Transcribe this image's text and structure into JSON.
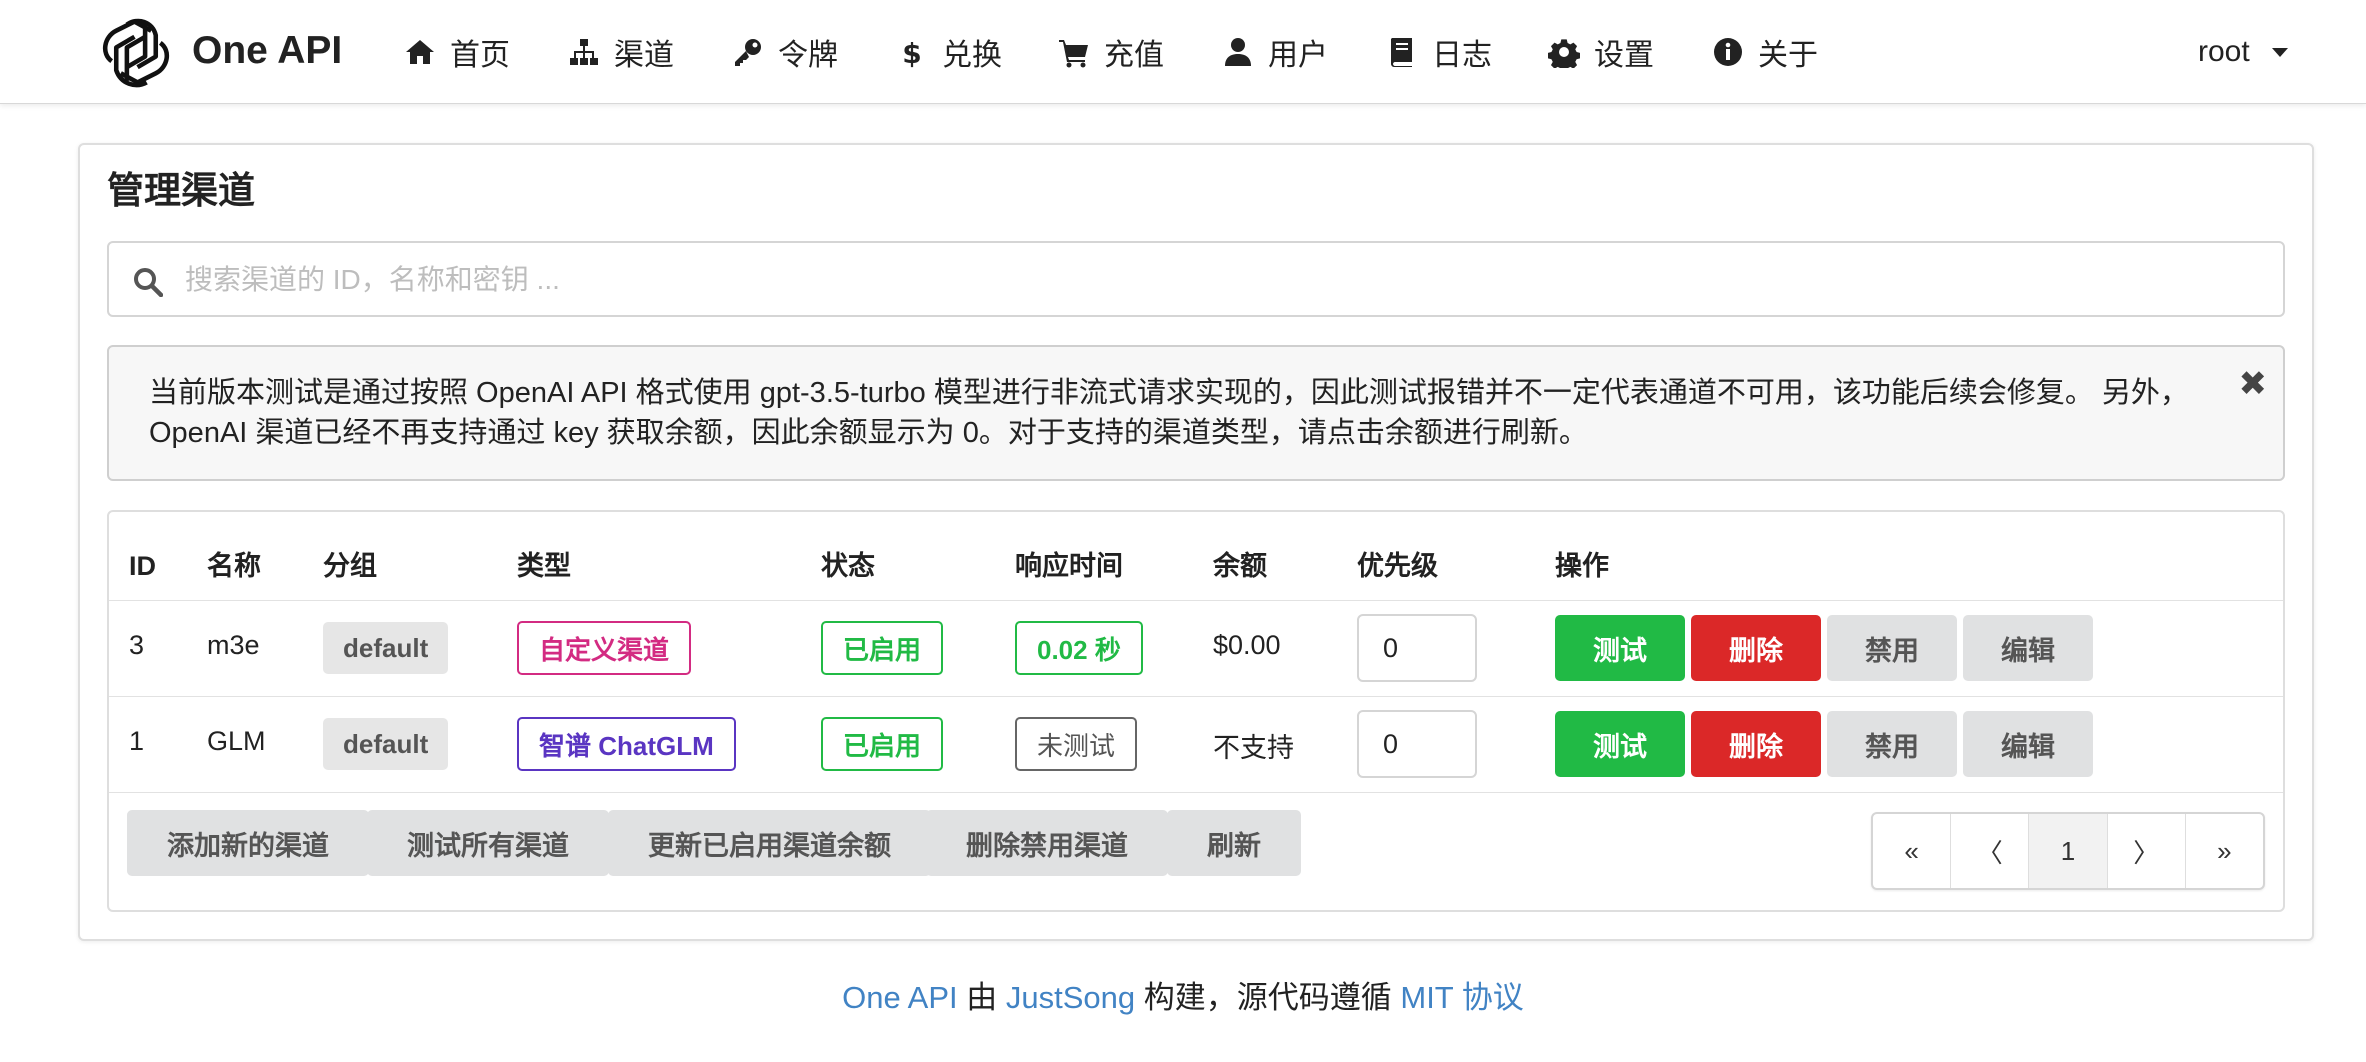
{
  "header": {
    "brand": "One API",
    "nav": [
      {
        "label": "首页",
        "icon": "home-icon"
      },
      {
        "label": "渠道",
        "icon": "sitemap-icon"
      },
      {
        "label": "令牌",
        "icon": "key-icon"
      },
      {
        "label": "兑换",
        "icon": "dollar-icon"
      },
      {
        "label": "充值",
        "icon": "cart-icon"
      },
      {
        "label": "用户",
        "icon": "user-icon"
      },
      {
        "label": "日志",
        "icon": "book-icon"
      },
      {
        "label": "设置",
        "icon": "gear-icon"
      },
      {
        "label": "关于",
        "icon": "info-icon"
      }
    ],
    "user": "root"
  },
  "page": {
    "title": "管理渠道",
    "search_placeholder": "搜索渠道的 ID，名称和密钥 ...",
    "notice": "当前版本测试是通过按照 OpenAI API 格式使用 gpt-3.5-turbo 模型进行非流式请求实现的，因此测试报错并不一定代表通道不可用，该功能后续会修复。 另外，OpenAI 渠道已经不再支持通过 key 获取余额，因此余额显示为 0。对于支持的渠道类型，请点击余额进行刷新。",
    "notice_close": "✖"
  },
  "table": {
    "headers": [
      "ID",
      "名称",
      "分组",
      "类型",
      "状态",
      "响应时间",
      "余额",
      "优先级",
      "操作"
    ],
    "rows": [
      {
        "id": "3",
        "name": "m3e",
        "group": "default",
        "type": "自定义渠道",
        "status": "已启用",
        "response": "0.02 秒",
        "balance": "$0.00",
        "priority": "0"
      },
      {
        "id": "1",
        "name": "GLM",
        "group": "default",
        "type": "智谱 ChatGLM",
        "status": "已启用",
        "response": "未测试",
        "balance": "不支持",
        "priority": "0"
      }
    ],
    "actions": {
      "test": "测试",
      "delete": "删除",
      "disable": "禁用",
      "edit": "编辑"
    },
    "footer_buttons": [
      "添加新的渠道",
      "测试所有渠道",
      "更新已启用渠道余额",
      "删除禁用渠道",
      "刷新"
    ],
    "pagination": {
      "first": "«",
      "prev": "〈",
      "current": "1",
      "next": "〉",
      "last": "»"
    }
  },
  "footer": {
    "app": "One API",
    "by": " 由 ",
    "author": "JustSong",
    "built": " 构建，源代码遵循 ",
    "license": "MIT 协议"
  },
  "colors": {
    "primary_link": "#4183c4",
    "green": "#21ba45",
    "red": "#db2828",
    "pink": "#d32b82",
    "violet": "#5a35c2"
  }
}
